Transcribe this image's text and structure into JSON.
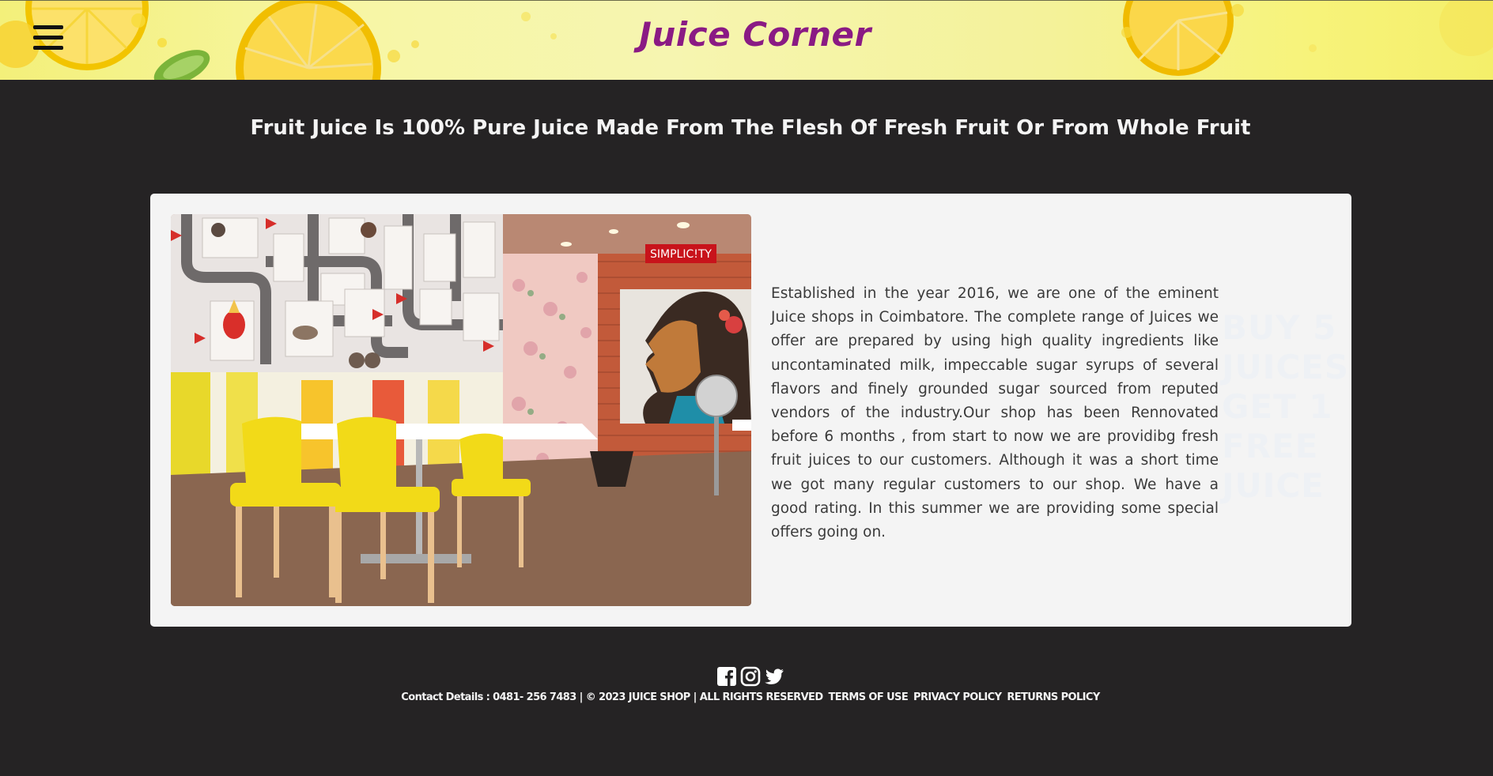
{
  "header": {
    "brand": "Juice Corner",
    "menu_icon": "hamburger-menu-icon"
  },
  "tagline": "Fruit Juice Is 100% Pure Juice Made From The Flesh Of Fresh Fruit Or From Whole Fruit",
  "about": {
    "image_icon": "juice-shop-interior-photo",
    "image_sign": "SIMPLIC!TY",
    "text": "Established in the year 2016, we are one of the eminent Juice shops in Coimbatore. The complete range of Juices we offer are prepared by using high quality ingredients like uncontaminated milk, impeccable sugar syrups of several flavors and finely grounded sugar sourced from reputed vendors of the industry.Our shop has been Rennovated before 6 months , from start to now we are providibg fresh fruit juices to our customers. Although it was a short time we got many regular customers to our shop. We have a good rating. In this summer we are providing some special offers going on."
  },
  "promo": {
    "line1": "BUY 5",
    "line2": "JUICES",
    "line3": "GET 1",
    "line4": "FREE",
    "line5": "JUICE"
  },
  "footer": {
    "social": [
      "facebook-icon",
      "instagram-icon",
      "twitter-icon"
    ],
    "contact": "Contact Details : 0481- 256 7483 | © 2023 JUICE SHOP | ALL RIGHTS RESERVED",
    "links": {
      "terms": "TERMS OF USE",
      "privacy": "PRIVACY POLICY",
      "returns": "RETURNS POLICY"
    }
  },
  "colors": {
    "background": "#252324",
    "brand": "#8a1a84",
    "card": "#f4f4f4",
    "header_yellow": "#f6f4a0"
  }
}
